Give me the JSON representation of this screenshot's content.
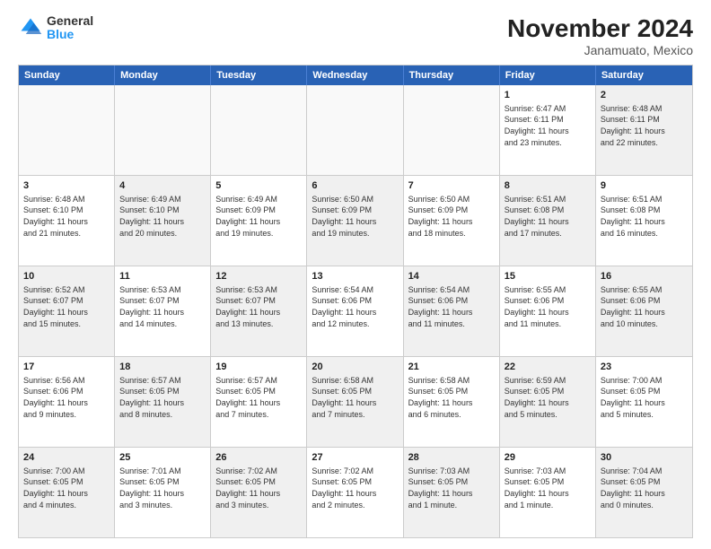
{
  "logo": {
    "general": "General",
    "blue": "Blue"
  },
  "title": "November 2024",
  "subtitle": "Janamuato, Mexico",
  "days": [
    "Sunday",
    "Monday",
    "Tuesday",
    "Wednesday",
    "Thursday",
    "Friday",
    "Saturday"
  ],
  "rows": [
    [
      {
        "day": "",
        "text": "",
        "empty": true
      },
      {
        "day": "",
        "text": "",
        "empty": true
      },
      {
        "day": "",
        "text": "",
        "empty": true
      },
      {
        "day": "",
        "text": "",
        "empty": true
      },
      {
        "day": "",
        "text": "",
        "empty": true
      },
      {
        "day": "1",
        "text": "Sunrise: 6:47 AM\nSunset: 6:11 PM\nDaylight: 11 hours\nand 23 minutes.",
        "empty": false
      },
      {
        "day": "2",
        "text": "Sunrise: 6:48 AM\nSunset: 6:11 PM\nDaylight: 11 hours\nand 22 minutes.",
        "empty": false,
        "shaded": true
      }
    ],
    [
      {
        "day": "3",
        "text": "Sunrise: 6:48 AM\nSunset: 6:10 PM\nDaylight: 11 hours\nand 21 minutes.",
        "empty": false
      },
      {
        "day": "4",
        "text": "Sunrise: 6:49 AM\nSunset: 6:10 PM\nDaylight: 11 hours\nand 20 minutes.",
        "empty": false,
        "shaded": true
      },
      {
        "day": "5",
        "text": "Sunrise: 6:49 AM\nSunset: 6:09 PM\nDaylight: 11 hours\nand 19 minutes.",
        "empty": false
      },
      {
        "day": "6",
        "text": "Sunrise: 6:50 AM\nSunset: 6:09 PM\nDaylight: 11 hours\nand 19 minutes.",
        "empty": false,
        "shaded": true
      },
      {
        "day": "7",
        "text": "Sunrise: 6:50 AM\nSunset: 6:09 PM\nDaylight: 11 hours\nand 18 minutes.",
        "empty": false
      },
      {
        "day": "8",
        "text": "Sunrise: 6:51 AM\nSunset: 6:08 PM\nDaylight: 11 hours\nand 17 minutes.",
        "empty": false,
        "shaded": true
      },
      {
        "day": "9",
        "text": "Sunrise: 6:51 AM\nSunset: 6:08 PM\nDaylight: 11 hours\nand 16 minutes.",
        "empty": false
      }
    ],
    [
      {
        "day": "10",
        "text": "Sunrise: 6:52 AM\nSunset: 6:07 PM\nDaylight: 11 hours\nand 15 minutes.",
        "empty": false,
        "shaded": true
      },
      {
        "day": "11",
        "text": "Sunrise: 6:53 AM\nSunset: 6:07 PM\nDaylight: 11 hours\nand 14 minutes.",
        "empty": false
      },
      {
        "day": "12",
        "text": "Sunrise: 6:53 AM\nSunset: 6:07 PM\nDaylight: 11 hours\nand 13 minutes.",
        "empty": false,
        "shaded": true
      },
      {
        "day": "13",
        "text": "Sunrise: 6:54 AM\nSunset: 6:06 PM\nDaylight: 11 hours\nand 12 minutes.",
        "empty": false
      },
      {
        "day": "14",
        "text": "Sunrise: 6:54 AM\nSunset: 6:06 PM\nDaylight: 11 hours\nand 11 minutes.",
        "empty": false,
        "shaded": true
      },
      {
        "day": "15",
        "text": "Sunrise: 6:55 AM\nSunset: 6:06 PM\nDaylight: 11 hours\nand 11 minutes.",
        "empty": false
      },
      {
        "day": "16",
        "text": "Sunrise: 6:55 AM\nSunset: 6:06 PM\nDaylight: 11 hours\nand 10 minutes.",
        "empty": false,
        "shaded": true
      }
    ],
    [
      {
        "day": "17",
        "text": "Sunrise: 6:56 AM\nSunset: 6:06 PM\nDaylight: 11 hours\nand 9 minutes.",
        "empty": false
      },
      {
        "day": "18",
        "text": "Sunrise: 6:57 AM\nSunset: 6:05 PM\nDaylight: 11 hours\nand 8 minutes.",
        "empty": false,
        "shaded": true
      },
      {
        "day": "19",
        "text": "Sunrise: 6:57 AM\nSunset: 6:05 PM\nDaylight: 11 hours\nand 7 minutes.",
        "empty": false
      },
      {
        "day": "20",
        "text": "Sunrise: 6:58 AM\nSunset: 6:05 PM\nDaylight: 11 hours\nand 7 minutes.",
        "empty": false,
        "shaded": true
      },
      {
        "day": "21",
        "text": "Sunrise: 6:58 AM\nSunset: 6:05 PM\nDaylight: 11 hours\nand 6 minutes.",
        "empty": false
      },
      {
        "day": "22",
        "text": "Sunrise: 6:59 AM\nSunset: 6:05 PM\nDaylight: 11 hours\nand 5 minutes.",
        "empty": false,
        "shaded": true
      },
      {
        "day": "23",
        "text": "Sunrise: 7:00 AM\nSunset: 6:05 PM\nDaylight: 11 hours\nand 5 minutes.",
        "empty": false
      }
    ],
    [
      {
        "day": "24",
        "text": "Sunrise: 7:00 AM\nSunset: 6:05 PM\nDaylight: 11 hours\nand 4 minutes.",
        "empty": false,
        "shaded": true
      },
      {
        "day": "25",
        "text": "Sunrise: 7:01 AM\nSunset: 6:05 PM\nDaylight: 11 hours\nand 3 minutes.",
        "empty": false
      },
      {
        "day": "26",
        "text": "Sunrise: 7:02 AM\nSunset: 6:05 PM\nDaylight: 11 hours\nand 3 minutes.",
        "empty": false,
        "shaded": true
      },
      {
        "day": "27",
        "text": "Sunrise: 7:02 AM\nSunset: 6:05 PM\nDaylight: 11 hours\nand 2 minutes.",
        "empty": false
      },
      {
        "day": "28",
        "text": "Sunrise: 7:03 AM\nSunset: 6:05 PM\nDaylight: 11 hours\nand 1 minute.",
        "empty": false,
        "shaded": true
      },
      {
        "day": "29",
        "text": "Sunrise: 7:03 AM\nSunset: 6:05 PM\nDaylight: 11 hours\nand 1 minute.",
        "empty": false
      },
      {
        "day": "30",
        "text": "Sunrise: 7:04 AM\nSunset: 6:05 PM\nDaylight: 11 hours\nand 0 minutes.",
        "empty": false,
        "shaded": true
      }
    ]
  ]
}
